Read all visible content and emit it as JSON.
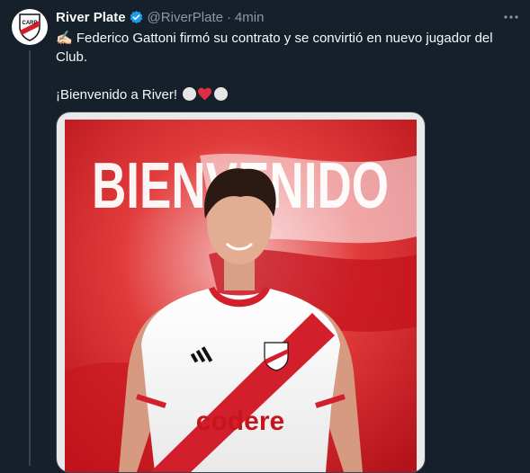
{
  "tweet": {
    "author_name": "River Plate",
    "handle": "@RiverPlate",
    "separator": "·",
    "time": "4min",
    "text_line1": "✍🏻 Federico Gattoni firmó su contrato y se convirtió en nuevo jugador del Club.",
    "text_line2": "¡Bienvenido a River!"
  },
  "media": {
    "headline": "BIENVENIDO",
    "sponsor": "codere",
    "kit_brand": "adidas"
  },
  "colors": {
    "background": "#15202b",
    "verified": "#1d9bf0",
    "muted": "#8b98a5",
    "river_red": "#d21f2b"
  }
}
